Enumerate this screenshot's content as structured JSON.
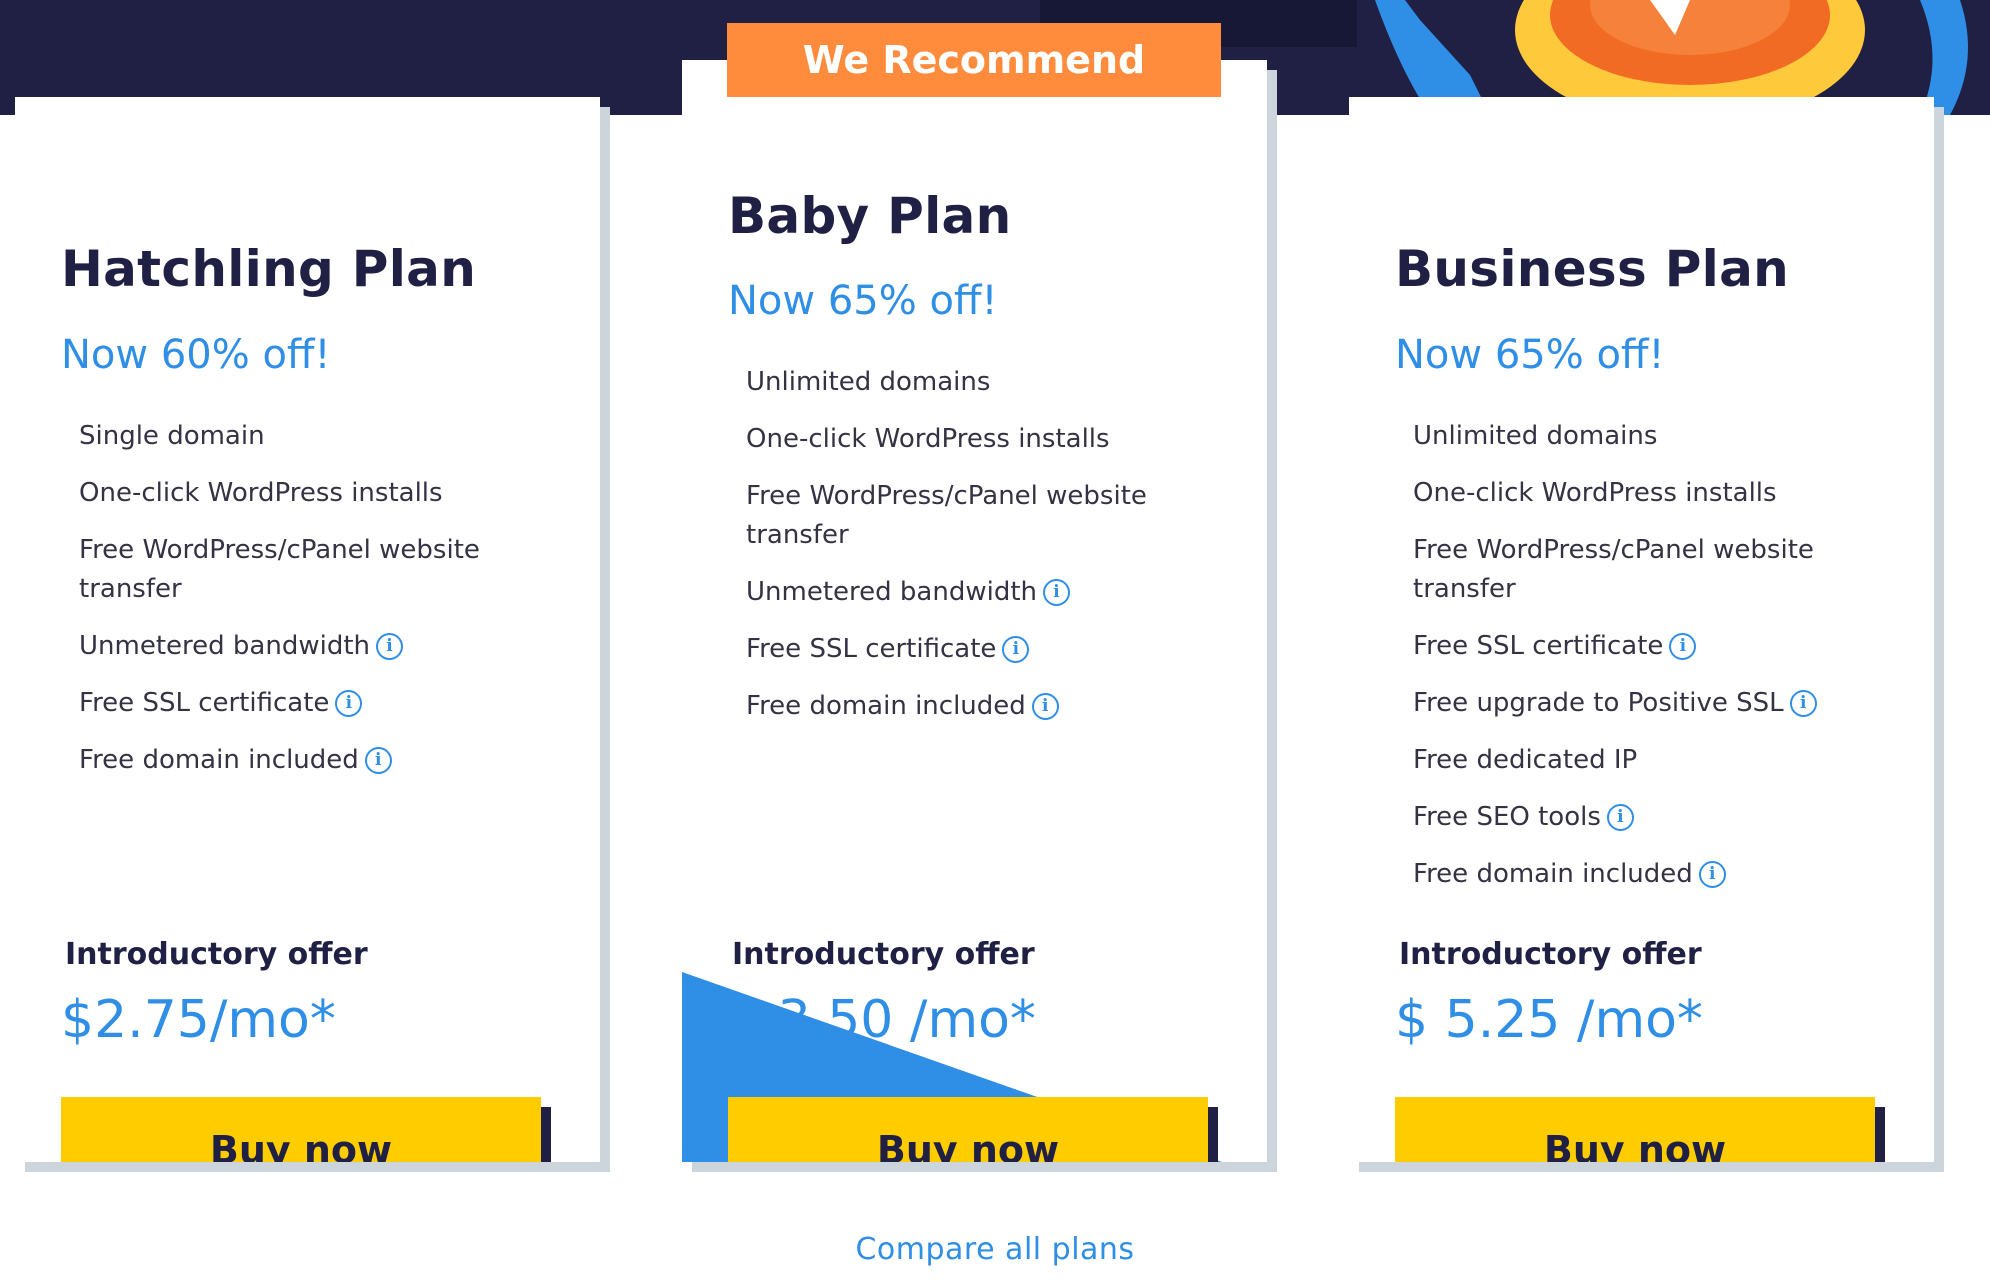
{
  "ribbon": {
    "label": "We Recommend"
  },
  "plans": [
    {
      "title": "Hatchling Plan",
      "discount": "Now 60% off!",
      "features": [
        {
          "text": "Single domain",
          "info": false
        },
        {
          "text": "One-click WordPress installs",
          "info": false
        },
        {
          "text": "Free WordPress/cPanel website transfer",
          "info": false
        },
        {
          "text": "Unmetered bandwidth",
          "info": true
        },
        {
          "text": "Free SSL certificate",
          "info": true
        },
        {
          "text": "Free domain included",
          "info": true
        }
      ],
      "offer_label": "Introductory offer",
      "price": "$2.75/mo*",
      "button": "Buy now"
    },
    {
      "title": "Baby Plan",
      "discount": "Now 65% off!",
      "features": [
        {
          "text": "Unlimited domains",
          "info": false
        },
        {
          "text": "One-click WordPress installs",
          "info": false
        },
        {
          "text": "Free WordPress/cPanel website transfer",
          "info": false
        },
        {
          "text": "Unmetered bandwidth",
          "info": true
        },
        {
          "text": "Free SSL certificate",
          "info": true
        },
        {
          "text": "Free domain included",
          "info": true
        }
      ],
      "offer_label": "Introductory offer",
      "price": "$ 3.50 /mo*",
      "button": "Buy now"
    },
    {
      "title": "Business Plan",
      "discount": "Now 65% off!",
      "features": [
        {
          "text": "Unlimited domains",
          "info": false
        },
        {
          "text": "One-click WordPress installs",
          "info": false
        },
        {
          "text": "Free WordPress/cPanel website transfer",
          "info": false
        },
        {
          "text": "Free SSL certificate",
          "info": true
        },
        {
          "text": "Free upgrade to Positive SSL",
          "info": true
        },
        {
          "text": "Free dedicated IP",
          "info": false
        },
        {
          "text": "Free SEO tools",
          "info": true
        },
        {
          "text": "Free domain included",
          "info": true
        }
      ],
      "offer_label": "Introductory offer",
      "price": "$ 5.25 /mo*",
      "button": "Buy now"
    }
  ],
  "info_icon_glyph": "i",
  "compare_link": "Compare all plans",
  "colors": {
    "navy": "#1f2044",
    "accent_blue": "#2f8ee6",
    "button_yellow": "#ffcc00",
    "ribbon_orange": "#ff8c3c"
  }
}
